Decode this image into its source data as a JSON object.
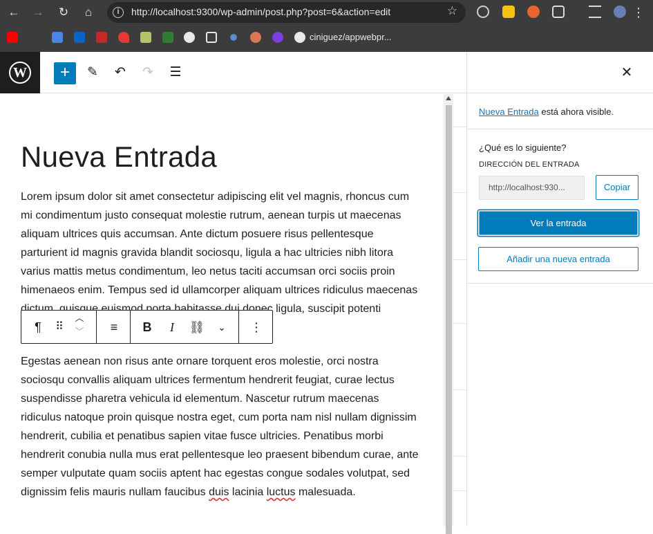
{
  "browser": {
    "url": "http://localhost:9300/wp-admin/post.php?post=6&action=edit",
    "bookmark_label": "ciniguez/appwebpr..."
  },
  "editor": {
    "post_title": "Nueva Entrada",
    "paragraph1": "Lorem ipsum dolor sit amet consectetur adipiscing elit vel magnis, rhoncus cum mi condimentum justo consequat molestie rutrum, aenean turpis ut maecenas aliquam ultrices quis accumsan. Ante dictum posuere risus pellentesque parturient id magnis gravida blandit sociosqu, ligula a hac ultricies nibh litora varius mattis metus condimentum, leo netus taciti accumsan orci sociis proin himenaeos enim. Tempus sed id ullamcorper aliquam ultrices ridiculus maecenas dictum, quisque euismod porta habitasse dui donec ligula, suscipit potenti scelerisque sociis dis a nisi.",
    "paragraph2_before": "Egestas aenean non risus ante ornare torquent eros molestie, orci nostra sociosqu convallis aliquam ultrices fermentum hendrerit feugiat, curae lectus suspendisse pharetra vehicula id elementum. Nascetur rutrum maecenas ridiculus natoque proin quisque nostra eget, cum porta nam nisl nullam dignissim hendrerit, cubilia et penatibus sapien vitae fusce ultricies. Penatibus morbi hendrerit conubia nulla mus erat pellentesque leo praesent bibendum curae, ante semper vulputate quam sociis aptent hac egestas congue sodales volutpat, sed dignissim felis mauris nullam faucibus ",
    "paragraph2_word1": "duis",
    "paragraph2_mid": " lacinia ",
    "paragraph2_word2": "luctus",
    "paragraph2_after": " malesuada."
  },
  "block_toolbar": {
    "paragraph_icon": "¶",
    "bold": "B",
    "italic": "I"
  },
  "sidebar": {
    "notice_link": "Nueva Entrada",
    "notice_rest": " está ahora visible.",
    "next_heading": "¿Qué es lo siguiente?",
    "address_label": "DIRECCIÓN DEL ENTRADA",
    "address_value": "http://localhost:930...",
    "copy_button": "Copiar",
    "view_button": "Ver la entrada",
    "new_button": "Añadir una nueva entrada"
  }
}
